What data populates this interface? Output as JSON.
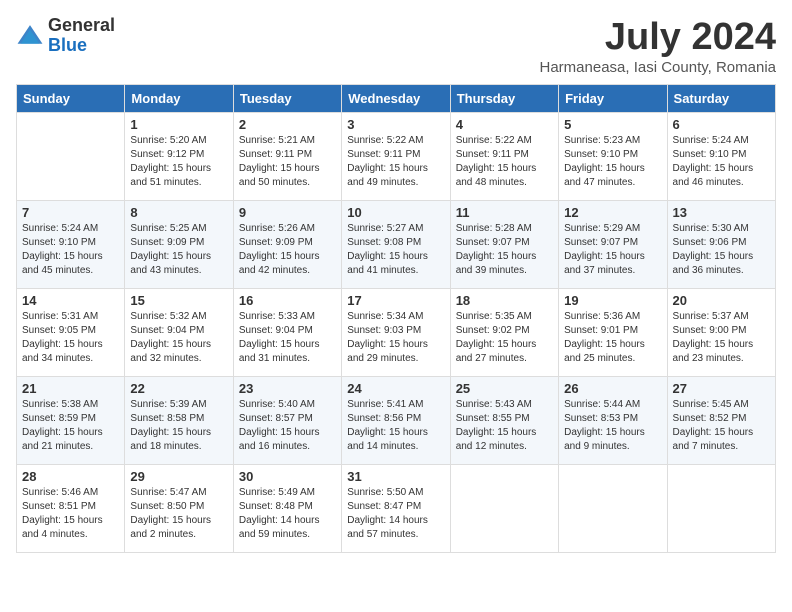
{
  "header": {
    "logo_general": "General",
    "logo_blue": "Blue",
    "title": "July 2024",
    "subtitle": "Harmaneasa, Iasi County, Romania"
  },
  "days_of_week": [
    "Sunday",
    "Monday",
    "Tuesday",
    "Wednesday",
    "Thursday",
    "Friday",
    "Saturday"
  ],
  "weeks": [
    [
      {
        "num": "",
        "detail": ""
      },
      {
        "num": "1",
        "detail": "Sunrise: 5:20 AM\nSunset: 9:12 PM\nDaylight: 15 hours\nand 51 minutes."
      },
      {
        "num": "2",
        "detail": "Sunrise: 5:21 AM\nSunset: 9:11 PM\nDaylight: 15 hours\nand 50 minutes."
      },
      {
        "num": "3",
        "detail": "Sunrise: 5:22 AM\nSunset: 9:11 PM\nDaylight: 15 hours\nand 49 minutes."
      },
      {
        "num": "4",
        "detail": "Sunrise: 5:22 AM\nSunset: 9:11 PM\nDaylight: 15 hours\nand 48 minutes."
      },
      {
        "num": "5",
        "detail": "Sunrise: 5:23 AM\nSunset: 9:10 PM\nDaylight: 15 hours\nand 47 minutes."
      },
      {
        "num": "6",
        "detail": "Sunrise: 5:24 AM\nSunset: 9:10 PM\nDaylight: 15 hours\nand 46 minutes."
      }
    ],
    [
      {
        "num": "7",
        "detail": "Sunrise: 5:24 AM\nSunset: 9:10 PM\nDaylight: 15 hours\nand 45 minutes."
      },
      {
        "num": "8",
        "detail": "Sunrise: 5:25 AM\nSunset: 9:09 PM\nDaylight: 15 hours\nand 43 minutes."
      },
      {
        "num": "9",
        "detail": "Sunrise: 5:26 AM\nSunset: 9:09 PM\nDaylight: 15 hours\nand 42 minutes."
      },
      {
        "num": "10",
        "detail": "Sunrise: 5:27 AM\nSunset: 9:08 PM\nDaylight: 15 hours\nand 41 minutes."
      },
      {
        "num": "11",
        "detail": "Sunrise: 5:28 AM\nSunset: 9:07 PM\nDaylight: 15 hours\nand 39 minutes."
      },
      {
        "num": "12",
        "detail": "Sunrise: 5:29 AM\nSunset: 9:07 PM\nDaylight: 15 hours\nand 37 minutes."
      },
      {
        "num": "13",
        "detail": "Sunrise: 5:30 AM\nSunset: 9:06 PM\nDaylight: 15 hours\nand 36 minutes."
      }
    ],
    [
      {
        "num": "14",
        "detail": "Sunrise: 5:31 AM\nSunset: 9:05 PM\nDaylight: 15 hours\nand 34 minutes."
      },
      {
        "num": "15",
        "detail": "Sunrise: 5:32 AM\nSunset: 9:04 PM\nDaylight: 15 hours\nand 32 minutes."
      },
      {
        "num": "16",
        "detail": "Sunrise: 5:33 AM\nSunset: 9:04 PM\nDaylight: 15 hours\nand 31 minutes."
      },
      {
        "num": "17",
        "detail": "Sunrise: 5:34 AM\nSunset: 9:03 PM\nDaylight: 15 hours\nand 29 minutes."
      },
      {
        "num": "18",
        "detail": "Sunrise: 5:35 AM\nSunset: 9:02 PM\nDaylight: 15 hours\nand 27 minutes."
      },
      {
        "num": "19",
        "detail": "Sunrise: 5:36 AM\nSunset: 9:01 PM\nDaylight: 15 hours\nand 25 minutes."
      },
      {
        "num": "20",
        "detail": "Sunrise: 5:37 AM\nSunset: 9:00 PM\nDaylight: 15 hours\nand 23 minutes."
      }
    ],
    [
      {
        "num": "21",
        "detail": "Sunrise: 5:38 AM\nSunset: 8:59 PM\nDaylight: 15 hours\nand 21 minutes."
      },
      {
        "num": "22",
        "detail": "Sunrise: 5:39 AM\nSunset: 8:58 PM\nDaylight: 15 hours\nand 18 minutes."
      },
      {
        "num": "23",
        "detail": "Sunrise: 5:40 AM\nSunset: 8:57 PM\nDaylight: 15 hours\nand 16 minutes."
      },
      {
        "num": "24",
        "detail": "Sunrise: 5:41 AM\nSunset: 8:56 PM\nDaylight: 15 hours\nand 14 minutes."
      },
      {
        "num": "25",
        "detail": "Sunrise: 5:43 AM\nSunset: 8:55 PM\nDaylight: 15 hours\nand 12 minutes."
      },
      {
        "num": "26",
        "detail": "Sunrise: 5:44 AM\nSunset: 8:53 PM\nDaylight: 15 hours\nand 9 minutes."
      },
      {
        "num": "27",
        "detail": "Sunrise: 5:45 AM\nSunset: 8:52 PM\nDaylight: 15 hours\nand 7 minutes."
      }
    ],
    [
      {
        "num": "28",
        "detail": "Sunrise: 5:46 AM\nSunset: 8:51 PM\nDaylight: 15 hours\nand 4 minutes."
      },
      {
        "num": "29",
        "detail": "Sunrise: 5:47 AM\nSunset: 8:50 PM\nDaylight: 15 hours\nand 2 minutes."
      },
      {
        "num": "30",
        "detail": "Sunrise: 5:49 AM\nSunset: 8:48 PM\nDaylight: 14 hours\nand 59 minutes."
      },
      {
        "num": "31",
        "detail": "Sunrise: 5:50 AM\nSunset: 8:47 PM\nDaylight: 14 hours\nand 57 minutes."
      },
      {
        "num": "",
        "detail": ""
      },
      {
        "num": "",
        "detail": ""
      },
      {
        "num": "",
        "detail": ""
      }
    ]
  ]
}
